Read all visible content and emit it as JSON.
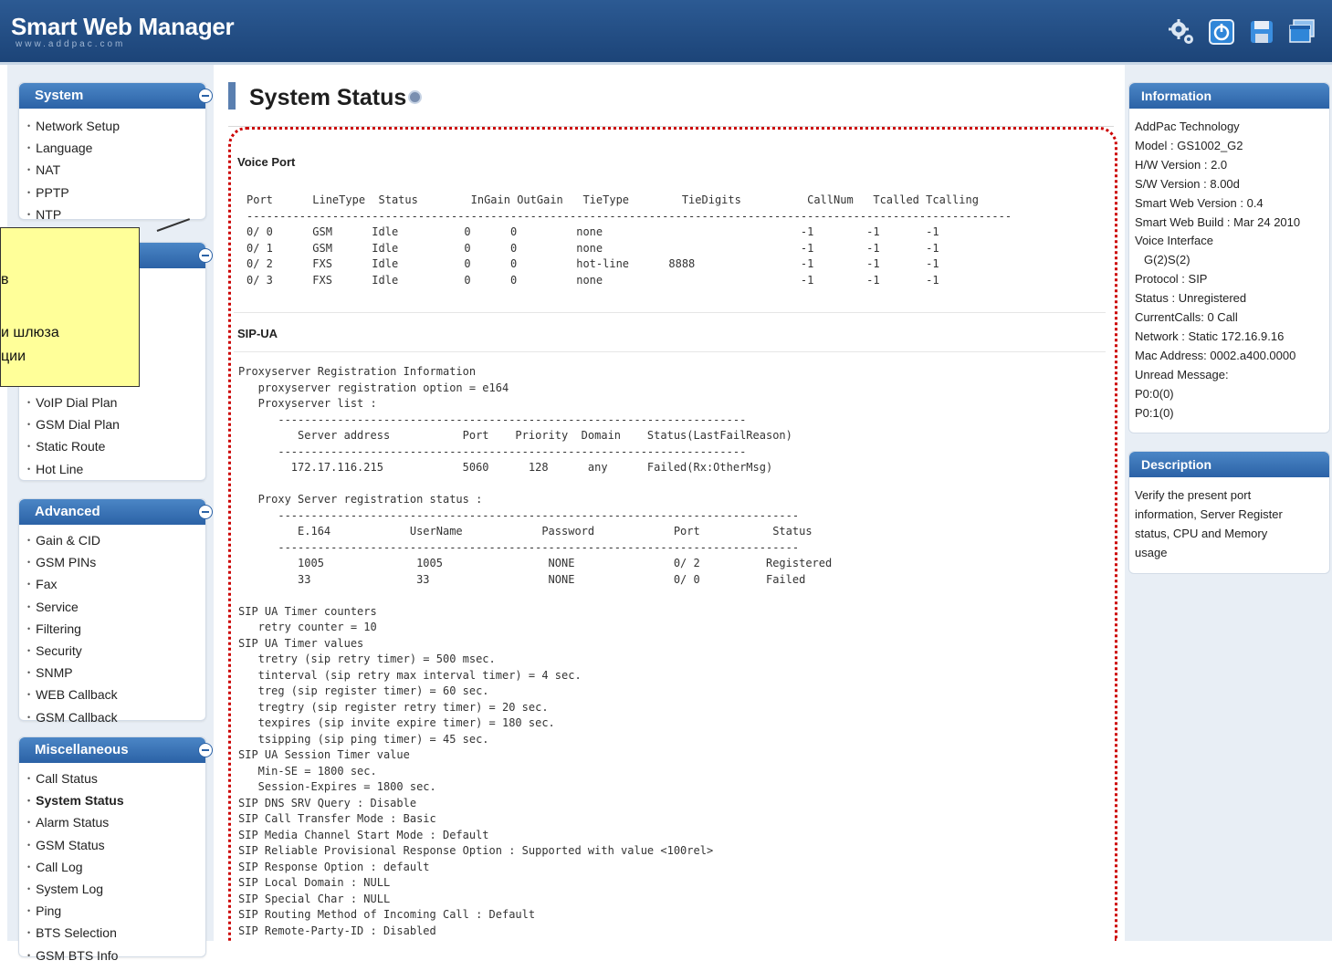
{
  "header": {
    "brand": "Smart Web Manager",
    "brand_sub": "www.addpac.com",
    "icons": [
      "settings-gear-icon",
      "power-icon",
      "save-disk-icon",
      "window-icon"
    ]
  },
  "left_sidebar": {
    "system": {
      "title": "System",
      "items": [
        "Network Setup",
        "Language",
        "NAT",
        "PPTP",
        "NTP"
      ]
    },
    "partial": {
      "items": [
        "VoIP Dial Plan",
        "GSM Dial Plan",
        "Static Route",
        "Hot Line"
      ]
    },
    "advanced": {
      "title": "Advanced",
      "items": [
        "Gain & CID",
        "GSM PINs",
        "Fax",
        "Service",
        "Filtering",
        "Security",
        "SNMP",
        "WEB Callback",
        "GSM Callback"
      ]
    },
    "misc": {
      "title": "Miscellaneous",
      "items": [
        "Call Status",
        "System Status",
        "Alarm Status",
        "GSM Status",
        "Call Log",
        "System Log",
        "Ping",
        "BTS Selection",
        "GSM BTS Info"
      ],
      "active": "System Status"
    }
  },
  "main": {
    "title": "System Status",
    "voice_port": {
      "label": "Voice Port",
      "text": "Port      LineType  Status        InGain OutGain   TieType        TieDigits          CallNum   Tcalled Tcalling\n--------------------------------------------------------------------------------------------------------------------\n0/ 0      GSM      Idle          0      0         none                              -1        -1       -1\n0/ 1      GSM      Idle          0      0         none                              -1        -1       -1\n0/ 2      FXS      Idle          0      0         hot-line      8888                -1        -1       -1\n0/ 3      FXS      Idle          0      0         none                              -1        -1       -1"
    },
    "sip_ua": {
      "label": "SIP-UA",
      "text": "Proxyserver Registration Information\n   proxyserver registration option = e164\n   Proxyserver list :\n      -----------------------------------------------------------------------\n         Server address           Port    Priority  Domain    Status(LastFailReason)\n      -----------------------------------------------------------------------\n        172.17.116.215            5060      128      any      Failed(Rx:OtherMsg)\n\n   Proxy Server registration status :\n      -------------------------------------------------------------------------------\n         E.164            UserName            Password            Port           Status\n      -------------------------------------------------------------------------------\n         1005              1005                NONE               0/ 2          Registered\n         33                33                  NONE               0/ 0          Failed\n\nSIP UA Timer counters\n   retry counter = 10\nSIP UA Timer values\n   tretry (sip retry timer) = 500 msec.\n   tinterval (sip retry max interval timer) = 4 sec.\n   treg (sip register timer) = 60 sec.\n   tregtry (sip register retry timer) = 20 sec.\n   texpires (sip invite expire timer) = 180 sec.\n   tsipping (sip ping timer) = 45 sec.\nSIP UA Session Timer value\n   Min-SE = 1800 sec.\n   Session-Expires = 1800 sec.\nSIP DNS SRV Query : Disable\nSIP Call Transfer Mode : Basic\nSIP Media Channel Start Mode : Default\nSIP Reliable Provisional Response Option : Supported with value <100rel>\nSIP Response Option : default\nSIP Local Domain : NULL\nSIP Special Char : NULL\nSIP Routing Method of Incoming Call : Default\nSIP Remote-Party-ID : Disabled"
    }
  },
  "right_sidebar": {
    "information": {
      "title": "Information",
      "lines": [
        "AddPac Technology",
        "Model : GS1002_G2",
        "H/W Version : 2.0",
        "S/W Version : 8.00d",
        "Smart Web Version : 0.4",
        "Smart Web Build : Mar 24 2010",
        "Voice Interface",
        "G(2)S(2)",
        "Protocol : SIP",
        "Status : Unregistered",
        "CurrentCalls: 0 Call",
        "Network : Static 172.16.9.16",
        "Mac Address: 0002.a400.0000",
        "Unread Message:",
        "P0:0(0)",
        "P0:1(0)"
      ]
    },
    "description": {
      "title": "Description",
      "text": [
        "Verify the present port",
        "information, Server Register",
        "status, CPU and Memory",
        "usage"
      ]
    }
  },
  "callout": {
    "line1": "в",
    "line2": "и шлюза",
    "line3": "ции"
  },
  "colors": {
    "header_bg": "#1f4a80",
    "panel_head": "#3a73b8",
    "highlight_border": "#cc0000",
    "callout_bg": "#ffff99"
  }
}
